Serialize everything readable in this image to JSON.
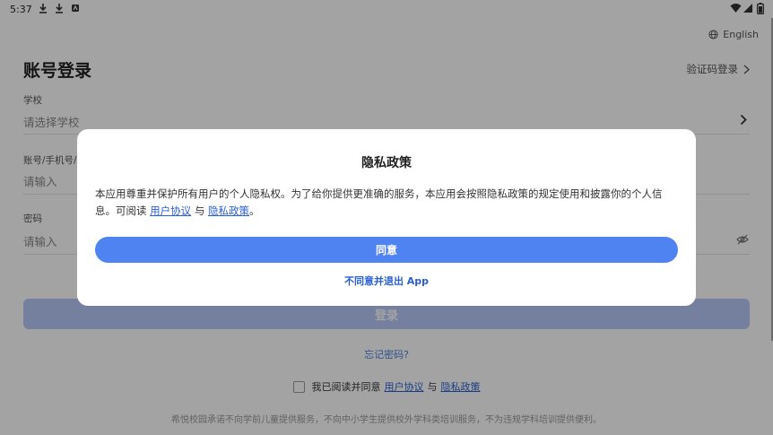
{
  "status_bar": {
    "time": "5:37",
    "left_icons": [
      "download-icon",
      "download-icon",
      "app-icon"
    ],
    "right_icons": [
      "wifi-icon",
      "signal-icon",
      "battery-icon"
    ]
  },
  "header": {
    "language": "English",
    "language_icon": "globe-icon",
    "title": "账号登录",
    "alt_login": "验证码登录"
  },
  "form": {
    "school_label": "学校",
    "school_placeholder": "请选择学校",
    "account_label": "账号/手机号/",
    "account_placeholder": "请输入",
    "password_label": "密码",
    "password_placeholder": "请输入",
    "login_button": "登录",
    "forgot_password": "忘记密码?"
  },
  "agreement": {
    "prefix": "我已阅读并同意",
    "user_agreement": "用户协议",
    "conjunction": "与",
    "privacy_policy": "隐私政策"
  },
  "footer_note": "希悦校园承诺不向学前儿童提供服务，不向中小学生提供校外学科类培训服务，不为违规学科培训提供便利。",
  "modal": {
    "title": "隐私政策",
    "body_text": "本应用尊重并保护所有用户的个人隐私权。为了给你提供更准确的服务，本应用会按照隐私政策的规定使用和披露你的个人信息。可阅读",
    "user_agreement_link": "用户协议",
    "conjunction": "与",
    "privacy_link": "隐私政策",
    "end_punct": "。",
    "agree_button": "同意",
    "disagree_link": "不同意并退出 App"
  },
  "colors": {
    "accent": "#4f83f1",
    "link": "#2a5fd0",
    "scrim": "rgba(0,0,0,0.36)",
    "login_button_disabled": "#b7c9f7"
  }
}
